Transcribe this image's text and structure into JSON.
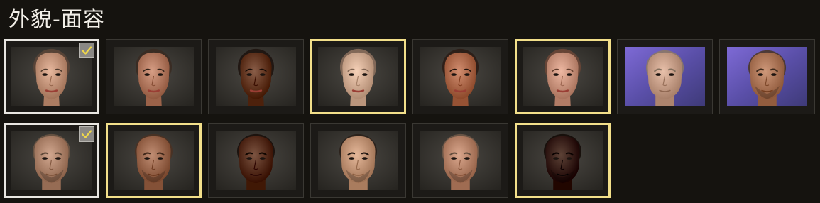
{
  "header": {
    "title": "外貌-面容"
  },
  "colors": {
    "background": "#15130f",
    "gold_border": "#f2df8a",
    "selected_border": "#e8e6e1",
    "check_mark": "#f0d84a"
  },
  "faces": [
    {
      "name": "face-1",
      "row": 1,
      "gender": "female",
      "skin": "#c99a80",
      "hair": "#5a4537",
      "bg": "dark",
      "gold": false,
      "selected": true,
      "checked": true
    },
    {
      "name": "face-2",
      "row": 1,
      "gender": "female",
      "skin": "#b98067",
      "hair": "#3a2b22",
      "bg": "dark",
      "gold": false,
      "selected": false,
      "checked": false
    },
    {
      "name": "face-3",
      "row": 1,
      "gender": "female",
      "skin": "#6b3f2a",
      "hair": "#1e1410",
      "bg": "dark",
      "gold": false,
      "selected": false,
      "checked": false
    },
    {
      "name": "face-4",
      "row": 1,
      "gender": "female",
      "skin": "#d8b39a",
      "hair": "#8a6e5c",
      "bg": "dark",
      "gold": true,
      "selected": false,
      "checked": false
    },
    {
      "name": "face-5",
      "row": 1,
      "gender": "female",
      "skin": "#b47052",
      "hair": "#2c1d16",
      "bg": "dark",
      "gold": false,
      "selected": false,
      "checked": false
    },
    {
      "name": "face-6",
      "row": 1,
      "gender": "female",
      "skin": "#d09a84",
      "hair": "#6a4636",
      "bg": "dark",
      "gold": true,
      "selected": false,
      "checked": false
    },
    {
      "name": "face-7",
      "row": 1,
      "gender": "male",
      "skin": "#caa28c",
      "hair": "#8c7866",
      "bg": "purple",
      "gold": false,
      "selected": false,
      "checked": false
    },
    {
      "name": "face-8",
      "row": 1,
      "gender": "male",
      "skin": "#b07a5c",
      "hair": "#4a3628",
      "bg": "purple",
      "gold": false,
      "selected": false,
      "checked": false
    },
    {
      "name": "face-9",
      "row": 2,
      "gender": "male",
      "skin": "#b48a72",
      "hair": "#6a5444",
      "bg": "dark",
      "gold": false,
      "selected": true,
      "checked": true
    },
    {
      "name": "face-10",
      "row": 2,
      "gender": "male",
      "skin": "#a26f55",
      "hair": "#4a3224",
      "bg": "dark",
      "gold": true,
      "selected": false,
      "checked": false
    },
    {
      "name": "face-11",
      "row": 2,
      "gender": "male",
      "skin": "#5e3623",
      "hair": "#1a100b",
      "bg": "dark",
      "gold": false,
      "selected": false,
      "checked": false
    },
    {
      "name": "face-12",
      "row": 2,
      "gender": "male",
      "skin": "#c79a7c",
      "hair": "#2a201a",
      "bg": "dark",
      "gold": false,
      "selected": false,
      "checked": false
    },
    {
      "name": "face-13",
      "row": 2,
      "gender": "male",
      "skin": "#bd8a70",
      "hair": "#6e5848",
      "bg": "dark",
      "gold": false,
      "selected": false,
      "checked": false
    },
    {
      "name": "face-14",
      "row": 2,
      "gender": "male",
      "skin": "#3f2418",
      "hair": "#140c08",
      "bg": "dark",
      "gold": true,
      "selected": false,
      "checked": false
    }
  ]
}
